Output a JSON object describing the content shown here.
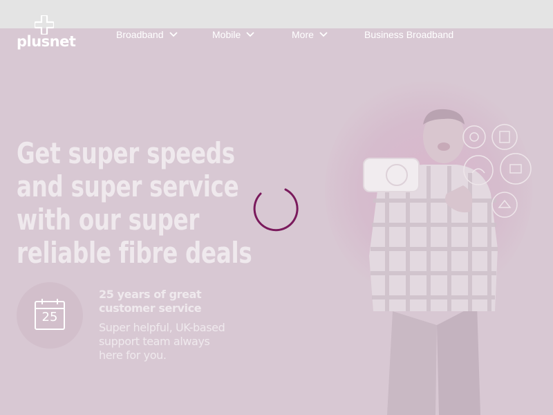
{
  "brand": {
    "name": "plusnet"
  },
  "nav": {
    "items": [
      {
        "label": "Broadband",
        "has_dropdown": true
      },
      {
        "label": "Mobile",
        "has_dropdown": true
      },
      {
        "label": "More",
        "has_dropdown": true
      },
      {
        "label": "Business Broadband",
        "has_dropdown": false
      }
    ]
  },
  "hero": {
    "headline_lines": [
      "Get super speeds",
      "and super service",
      "with our super",
      "reliable fibre deals"
    ]
  },
  "feature": {
    "calendar_number": "25",
    "title": "25 years of great customer service",
    "body": "Super helpful, UK-based support team always here for you."
  },
  "state": {
    "loading": true
  },
  "colors": {
    "brand_purple": "#7a1a5c",
    "overlay_tint": "#d8c8d3",
    "top_strip": "#e4e4e4"
  },
  "icons": [
    "plus-logo-icon",
    "chevron-down-icon",
    "calendar-icon",
    "loading-spinner-icon",
    "router-icon",
    "service-bubble-icon"
  ]
}
